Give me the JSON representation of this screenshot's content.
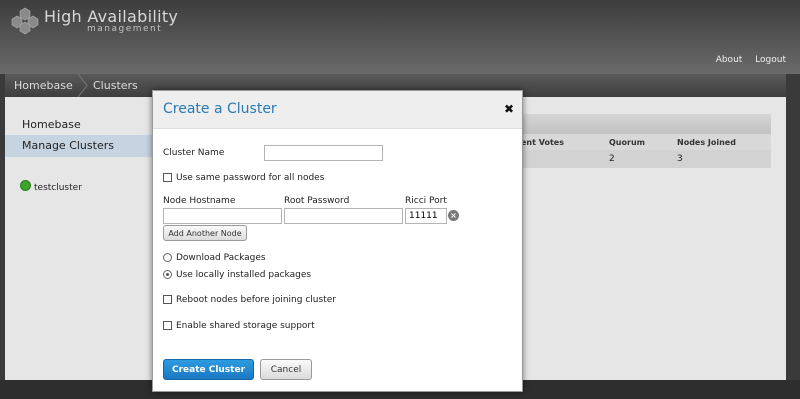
{
  "header": {
    "title": "High Availability",
    "subtitle": "management",
    "links": [
      "About",
      "Logout"
    ]
  },
  "breadcrumb": [
    "Homebase",
    "Clusters"
  ],
  "sidebar": {
    "items": [
      {
        "label": "Homebase",
        "active": false
      },
      {
        "label": "Manage Clusters",
        "active": true
      }
    ],
    "clusters": [
      {
        "name": "testcluster",
        "status": "running"
      }
    ]
  },
  "table": {
    "columns": [
      "ent Votes",
      "Quorum",
      "Nodes Joined"
    ],
    "rows": [
      [
        "",
        "2",
        "3"
      ]
    ]
  },
  "modal": {
    "title": "Create a Cluster",
    "close_glyph": "✖",
    "cluster_name_label": "Cluster Name",
    "cluster_name_value": "",
    "same_password_label": "Use same password for all nodes",
    "same_password_checked": false,
    "node_columns": [
      "Node Hostname",
      "Root Password",
      "Ricci Port"
    ],
    "nodes": [
      {
        "hostname": "",
        "password": "",
        "port": "11111"
      }
    ],
    "add_node_label": "Add Another Node",
    "package_options": [
      {
        "label": "Download Packages",
        "selected": false
      },
      {
        "label": "Use locally installed packages",
        "selected": true
      }
    ],
    "reboot_label": "Reboot nodes before joining cluster",
    "reboot_checked": false,
    "shared_storage_label": "Enable shared storage support",
    "shared_storage_checked": false,
    "create_label": "Create Cluster",
    "cancel_label": "Cancel"
  },
  "colors": {
    "accent": "#2a79b4",
    "primary_button": "#1a78c2",
    "status_ok": "#3aa528",
    "active_nav": "#c6d4e2"
  }
}
